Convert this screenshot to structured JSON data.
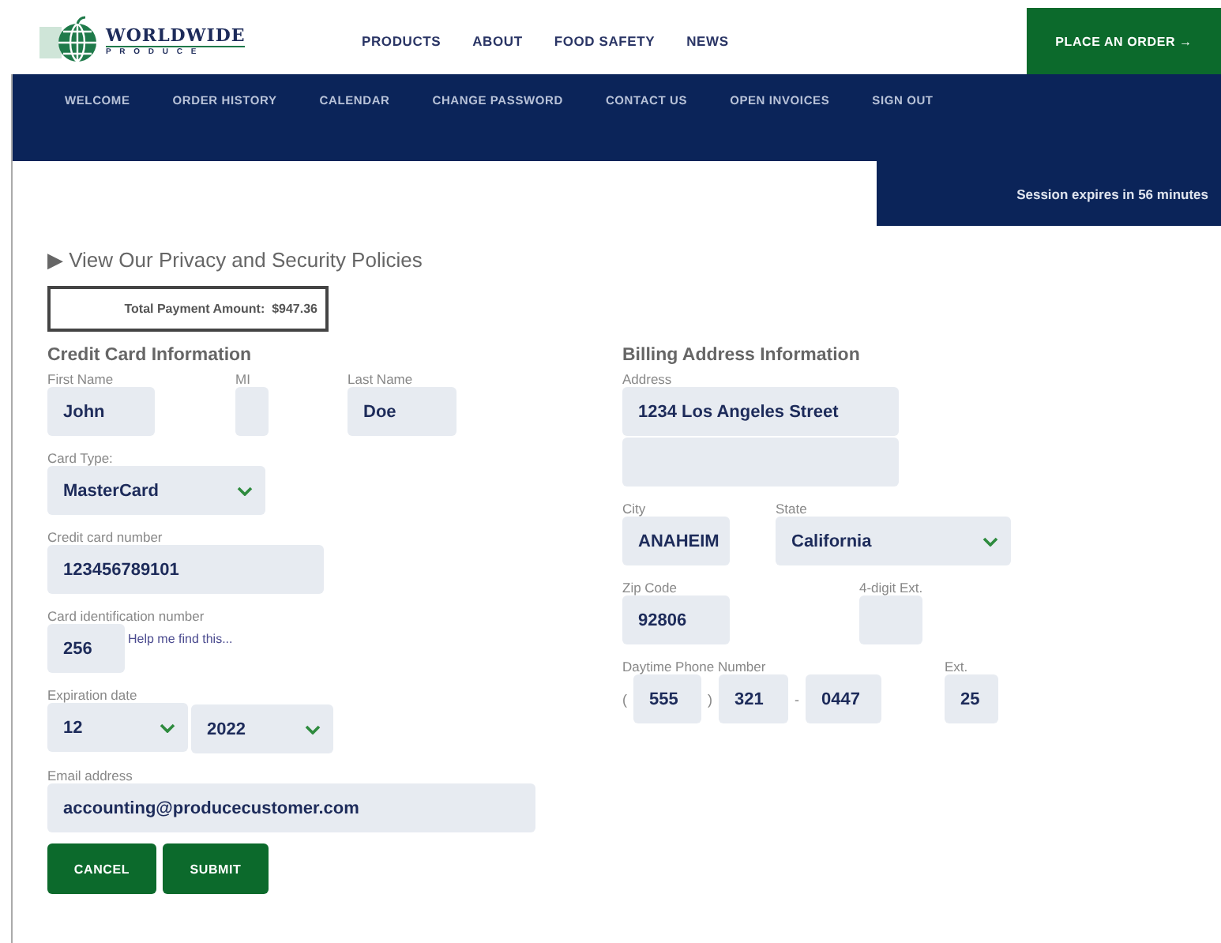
{
  "logo": {
    "name": "WORLDWIDE",
    "tagline": "P R O D U C E"
  },
  "main_nav": [
    "PRODUCTS",
    "ABOUT",
    "FOOD SAFETY",
    "NEWS"
  ],
  "order_button": {
    "label": "PLACE AN ORDER",
    "arrow": "→"
  },
  "account_nav": [
    "WELCOME",
    "ORDER HISTORY",
    "CALENDAR",
    "CHANGE PASSWORD",
    "CONTACT US",
    "OPEN INVOICES",
    "SIGN OUT"
  ],
  "session_notice": "Session expires in 56 minutes",
  "privacy_toggle": {
    "marker": "▶",
    "label": "View Our Privacy and Security Policies"
  },
  "total_payment": {
    "label": "Total Payment Amount:",
    "value": "$947.36"
  },
  "credit_card": {
    "heading": "Credit Card Information",
    "first_name": {
      "label": "First Name",
      "value": "John"
    },
    "mi": {
      "label": "MI"
    },
    "last_name": {
      "label": "Last Name",
      "value": "Doe"
    },
    "card_type": {
      "label": "Card Type:",
      "value": "MasterCard"
    },
    "card_number": {
      "label": "Credit card number",
      "value": "123456789101"
    },
    "card_id": {
      "label": "Card identification number",
      "value": "256",
      "help_link": "Help me find this..."
    },
    "expiration": {
      "label": "Expiration date",
      "month": "12",
      "year": "2022"
    },
    "email": {
      "label": "Email address",
      "value": "accounting@producecustomer.com"
    }
  },
  "billing": {
    "heading": "Billing Address Information",
    "address": {
      "label": "Address",
      "line1": "1234 Los Angeles Street"
    },
    "city": {
      "label": "City",
      "value": "ANAHEIM"
    },
    "state": {
      "label": "State",
      "value": "California"
    },
    "zip": {
      "label": "Zip Code",
      "value": "92806"
    },
    "zip_ext": {
      "label": "4-digit Ext."
    },
    "phone": {
      "label": "Daytime Phone Number",
      "open": "(",
      "area": "555",
      "close": ")",
      "prefix": "321",
      "dash": "-",
      "line": "0447"
    },
    "ext": {
      "label": "Ext.",
      "value": "25"
    }
  },
  "buttons": [
    "CANCEL",
    "SUBMIT"
  ]
}
